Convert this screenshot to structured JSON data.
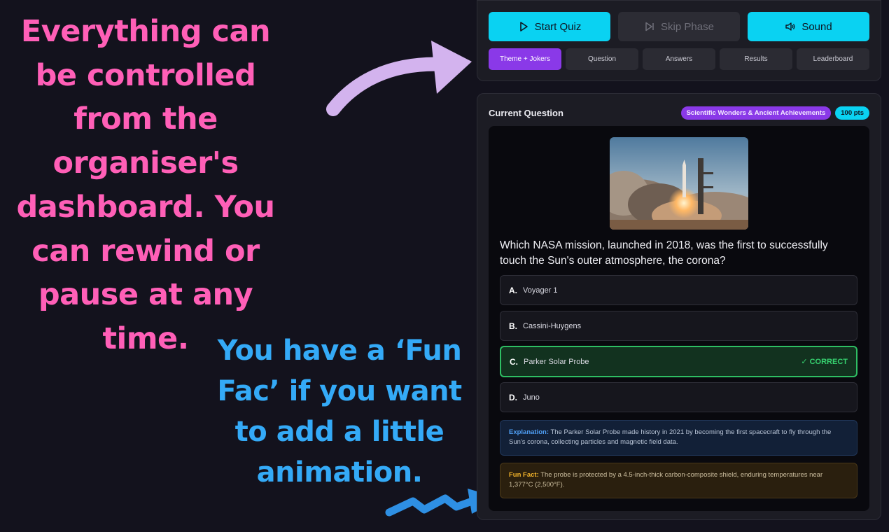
{
  "captions": {
    "organiser": "Everything can be controlled from the organiser's dashboard. You can rewind or pause at any time.",
    "funfact": "You have a ‘Fun Fac’ if you want to add a little animation."
  },
  "controls": {
    "start_label": "Start Quiz",
    "skip_label": "Skip Phase",
    "sound_label": "Sound",
    "tabs": [
      "Theme + Jokers",
      "Question",
      "Answers",
      "Results",
      "Leaderboard"
    ],
    "active_tab": "Theme + Jokers"
  },
  "question": {
    "panel_title": "Current Question",
    "category": "Scientific Wonders & Ancient Achievements",
    "points": "100 pts",
    "text": "Which NASA mission, launched in 2018, was the first to successfully touch the Sun's outer atmosphere, the corona?",
    "answers": [
      {
        "letter": "A.",
        "text": "Voyager 1"
      },
      {
        "letter": "B.",
        "text": "Cassini-Huygens"
      },
      {
        "letter": "C.",
        "text": "Parker Solar Probe"
      },
      {
        "letter": "D.",
        "text": "Juno"
      }
    ],
    "correct_tag": "✓ CORRECT",
    "explanation_label": "Explanation:",
    "explanation": " The Parker Solar Probe made history in 2021 by becoming the first spacecraft to fly through the Sun's corona, collecting particles and magnetic field data.",
    "funfact_label": "Fun Fact:",
    "funfact": " The probe is protected by a 4.5-inch-thick carbon-composite shield, enduring temperatures near 1,377°C (2,500°F)."
  },
  "colors": {
    "accent_cyan": "#0ad2f2",
    "accent_purple": "#8a39e8",
    "correct_green": "#2ebe63",
    "caption_pink": "#ff5fb7",
    "caption_blue": "#34aaf7"
  }
}
